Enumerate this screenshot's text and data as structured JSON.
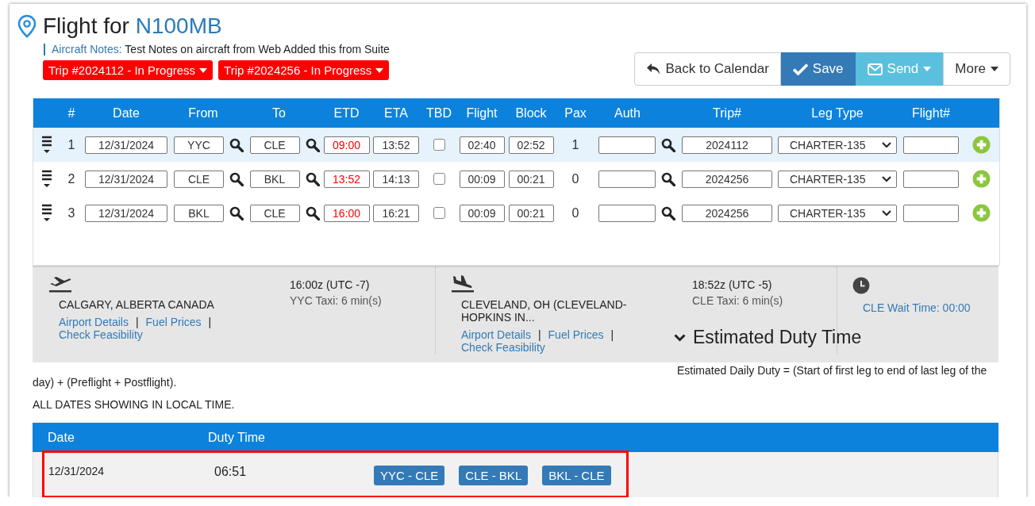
{
  "title": {
    "prefix": "Flight for",
    "tail": "N100MB"
  },
  "aircraft_notes": {
    "label": "Aircraft Notes:",
    "text": "Test Notes on aircraft from Web Added this from Suite"
  },
  "trip_badges": [
    "Trip #2024112 - In Progress",
    "Trip #2024256 - In Progress"
  ],
  "toolbar": [
    {
      "label": "Back to Calendar",
      "kind": "back"
    },
    {
      "label": "Save",
      "kind": "save"
    },
    {
      "label": "Send",
      "kind": "send"
    },
    {
      "label": "More",
      "kind": "more"
    }
  ],
  "legs": {
    "columns": [
      "#",
      "Date",
      "From",
      "To",
      "ETD",
      "ETA",
      "TBD",
      "Flight",
      "Block",
      "Pax",
      "Auth",
      "Trip#",
      "Leg Type",
      "Flight#"
    ],
    "rows": [
      {
        "number": "1",
        "date": "12/31/2024",
        "from": "YYC",
        "to": "CLE",
        "etd": "09:00",
        "eta": "13:52",
        "tbd": false,
        "flight": "02:40",
        "block": "02:52",
        "pax": "1",
        "trip": "2024112",
        "leg_type": "CHARTER-135",
        "selected": true
      },
      {
        "number": "2",
        "date": "12/31/2024",
        "from": "CLE",
        "to": "BKL",
        "etd": "13:52",
        "eta": "14:13",
        "tbd": false,
        "flight": "00:09",
        "block": "00:21",
        "pax": "0",
        "trip": "2024256",
        "leg_type": "CHARTER-135",
        "selected": false
      },
      {
        "number": "3",
        "date": "12/31/2024",
        "from": "BKL",
        "to": "CLE",
        "etd": "16:00",
        "eta": "16:21",
        "tbd": false,
        "flight": "00:09",
        "block": "00:21",
        "pax": "0",
        "trip": "2024256",
        "leg_type": "CHARTER-135",
        "selected": false
      }
    ]
  },
  "departure": {
    "city": "CALGARY, ALBERTA CANADA",
    "time": "16:00z (UTC -7)",
    "taxi": "YYC Taxi: 6 min(s)",
    "links": [
      "Airport Details",
      "Fuel Prices",
      "Check Feasibility"
    ],
    "separators": [
      "|",
      "|"
    ]
  },
  "arrival": {
    "city": "CLEVELAND, OH (CLEVELAND-HOPKINS IN...",
    "time": "18:52z (UTC -5)",
    "taxi": "CLE Taxi: 6 min(s)",
    "links": [
      "Airport Details",
      "Fuel Prices",
      "Check Feasibility"
    ],
    "separators": [
      "|",
      "|"
    ]
  },
  "wait_time": "CLE Wait Time: 00:00",
  "duty": {
    "heading": "Estimated Duty Time",
    "description": "Estimated Daily Duty = (Start of first leg to end of last leg of the day) + (Preflight + Postflight).",
    "timezone_note": "ALL DATES SHOWING IN LOCAL TIME.",
    "columns": [
      "Date",
      "Duty Time"
    ],
    "rows": [
      {
        "date": "12/31/2024",
        "duty_time": "06:51",
        "legs": [
          "YYC - CLE",
          "CLE - BKL",
          "BKL - CLE"
        ],
        "highlighted": true
      }
    ]
  }
}
